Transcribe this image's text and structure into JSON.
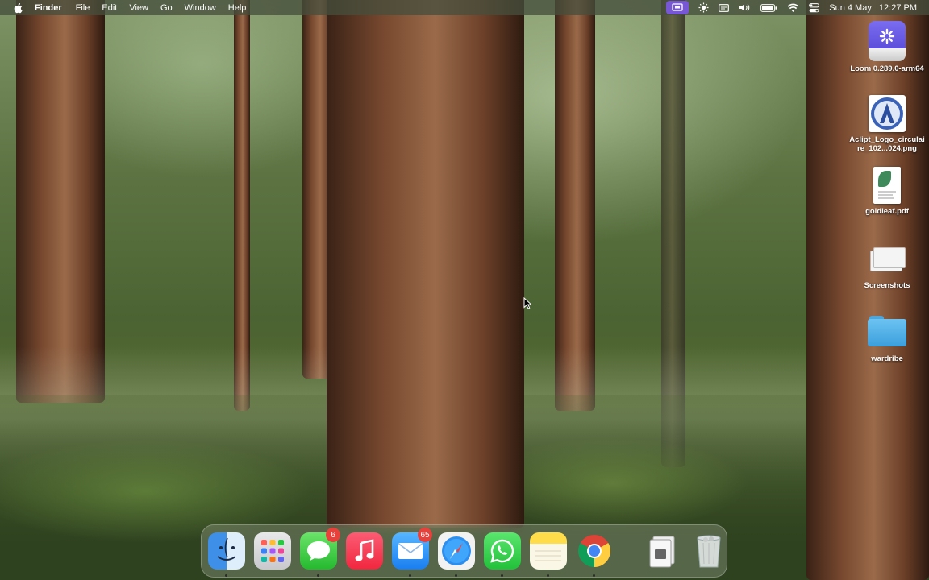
{
  "menubar": {
    "app_name": "Finder",
    "menus": [
      "File",
      "Edit",
      "View",
      "Go",
      "Window",
      "Help"
    ],
    "status_icons": [
      "screen-recording-icon",
      "brightness-icon",
      "display-icon",
      "volume-icon",
      "battery-icon",
      "wifi-icon",
      "control-center-icon"
    ],
    "date": "Sun 4 May",
    "time": "12:27 PM"
  },
  "desktop": {
    "icons": [
      {
        "label": "Loom 0.289.0-arm64",
        "icon": "disk-image-icon"
      },
      {
        "label": "Aclipt_Logo_circulaire_102...024.png",
        "icon": "image-file-icon"
      },
      {
        "label": "goldleaf.pdf",
        "icon": "pdf-file-icon"
      },
      {
        "label": "Screenshots",
        "icon": "screenshots-folder-icon"
      },
      {
        "label": "wardribe",
        "icon": "folder-icon"
      }
    ]
  },
  "dock": {
    "apps": [
      {
        "name": "Finder",
        "icon": "finder-icon",
        "running": true
      },
      {
        "name": "Launchpad",
        "icon": "launchpad-icon",
        "running": false
      },
      {
        "name": "Messages",
        "icon": "messages-icon",
        "running": true,
        "badge": "6"
      },
      {
        "name": "Music",
        "icon": "music-icon",
        "running": false
      },
      {
        "name": "Mail",
        "icon": "mail-icon",
        "running": true,
        "badge": "65"
      },
      {
        "name": "Safari",
        "icon": "safari-icon",
        "running": true
      },
      {
        "name": "WhatsApp",
        "icon": "whatsapp-icon",
        "running": true
      },
      {
        "name": "Notes",
        "icon": "notes-icon",
        "running": true
      },
      {
        "name": "Google Chrome",
        "icon": "chrome-icon",
        "running": true
      },
      {
        "name": "Downloads",
        "icon": "downloads-stack-icon",
        "running": false
      },
      {
        "name": "Trash",
        "icon": "trash-icon",
        "running": false
      }
    ]
  },
  "colors": {
    "menubar_bg": "#464e3c",
    "active_status": "#7857d6",
    "badge": "#e8413b"
  }
}
